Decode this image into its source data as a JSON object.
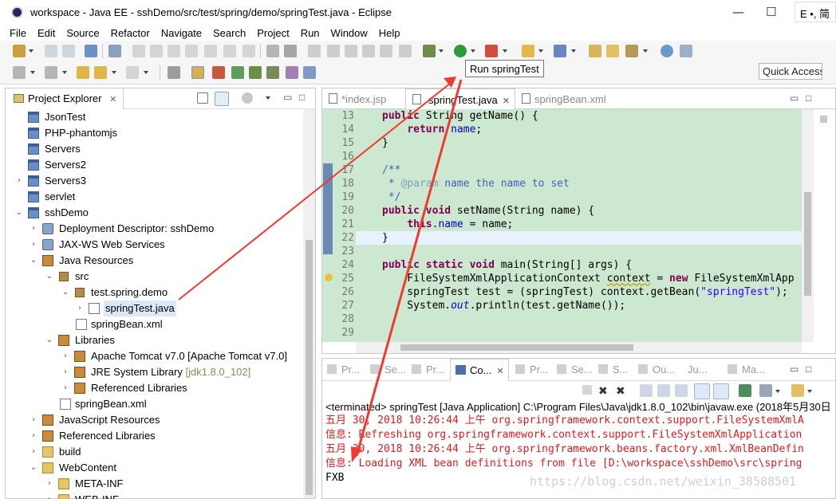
{
  "window": {
    "title": "workspace - Java EE - sshDemo/src/test/spring/demo/springTest.java - Eclipse",
    "minimize": "—",
    "maximize": "☐",
    "ime_indicator": "E •, 简"
  },
  "menubar": [
    "File",
    "Edit",
    "Source",
    "Refactor",
    "Navigate",
    "Search",
    "Project",
    "Run",
    "Window",
    "Help"
  ],
  "toolbar": {
    "run_tooltip": "Run springTest",
    "quick_access": "Quick Access"
  },
  "project_explorer": {
    "tab_label": "Project Explorer",
    "items": [
      {
        "label": "JsonTest",
        "icon": "project-icon"
      },
      {
        "label": "PHP-phantomjs",
        "icon": "project-icon"
      },
      {
        "label": "Servers",
        "icon": "project-icon"
      },
      {
        "label": "Servers2",
        "icon": "project-icon"
      },
      {
        "label": "Servers3",
        "icon": "project-icon"
      },
      {
        "label": "servlet",
        "icon": "project-icon"
      },
      {
        "label": "sshDemo",
        "icon": "web-project-icon"
      },
      {
        "label": "Deployment Descriptor: sshDemo",
        "icon": "deployment-icon"
      },
      {
        "label": "JAX-WS Web Services",
        "icon": "web-services-icon"
      },
      {
        "label": "Java Resources",
        "icon": "java-resources-icon"
      },
      {
        "label": "src",
        "icon": "source-folder-icon"
      },
      {
        "label": "test.spring.demo",
        "icon": "package-icon"
      },
      {
        "label": "springTest.java",
        "icon": "java-file-icon"
      },
      {
        "label": "springBean.xml",
        "icon": "xml-file-icon"
      },
      {
        "label": "Libraries",
        "icon": "libraries-icon"
      },
      {
        "label": "Apache Tomcat v7.0 [Apache Tomcat v7.0]",
        "icon": "library-icon"
      },
      {
        "label": "JRE System Library",
        "suffix": "[jdk1.8.0_102]",
        "icon": "library-icon"
      },
      {
        "label": "Referenced Libraries",
        "icon": "library-icon"
      },
      {
        "label": "springBean.xml",
        "icon": "xml-file-icon"
      },
      {
        "label": "JavaScript Resources",
        "icon": "js-resources-icon"
      },
      {
        "label": "Referenced Libraries",
        "icon": "library-icon"
      },
      {
        "label": "build",
        "icon": "folder-icon"
      },
      {
        "label": "WebContent",
        "icon": "folder-icon"
      },
      {
        "label": "META-INF",
        "icon": "folder-icon"
      },
      {
        "label": "WEB-INF",
        "icon": "folder-icon"
      }
    ]
  },
  "editor": {
    "tabs": [
      "*index.jsp",
      "springTest.java",
      "springBean.xml"
    ],
    "line_numbers": [
      "13",
      "14",
      "15",
      "16",
      "17",
      "18",
      "19",
      "20",
      "21",
      "22",
      "23",
      "24",
      "25",
      "26",
      "27",
      "28",
      "29"
    ]
  },
  "console": {
    "tabs": [
      "Pr...",
      "Se...",
      "Pr...",
      "Co...",
      "Pr...",
      "Se...",
      "S...",
      "Ou...",
      "Ju...",
      "Ma..."
    ],
    "status": "<terminated> springTest [Java Application] C:\\Program Files\\Java\\jdk1.8.0_102\\bin\\javaw.exe (2018年5月30日",
    "lines": [
      "五月 30, 2018 10:26:44 上午 org.springframework.context.support.FileSystemXmlA",
      "信息: Refreshing org.springframework.context.support.FileSystemXmlApplication",
      "五月 30, 2018 10:26:44 上午 org.springframework.beans.factory.xml.XmlBeanDefin",
      "信息: Loading XML bean definitions from file [D:\\workspace\\sshDemo\\src\\spring"
    ],
    "output": "FXB",
    "watermark": "https://blog.csdn.net/weixin_38588501"
  },
  "colors": {
    "code_background": "#cde8d0",
    "keyword": "#7f0055",
    "console_error": "#e01b1b",
    "annotation_arrow": "#ee3b30"
  }
}
